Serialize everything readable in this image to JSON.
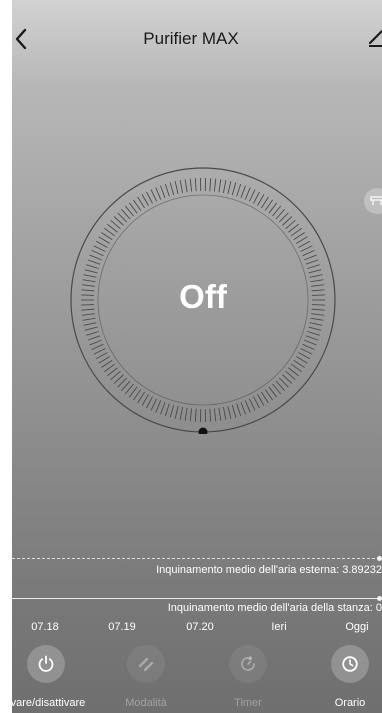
{
  "header": {
    "title": "Purifier MAX",
    "back_icon": "chevron-left-icon",
    "edit_icon": "pencil-icon"
  },
  "side_button": {
    "icon": "filter-icon"
  },
  "dial": {
    "status": "Off",
    "level_fraction": 0
  },
  "metrics": {
    "outdoor": "Inquinamento medio dell'aria esterna: 3.89232",
    "indoor": "Inquinamento medio dell'aria della stanza: 0"
  },
  "dates": [
    "07.18",
    "07.19",
    "07.20",
    "Ieri",
    "Oggi"
  ],
  "actions": [
    {
      "label": "Attivare/disattivare",
      "icon": "power-icon",
      "enabled": true
    },
    {
      "label": "Modalità",
      "icon": "mode-icon",
      "enabled": false
    },
    {
      "label": "Timer",
      "icon": "timer-icon",
      "enabled": false
    },
    {
      "label": "Orario",
      "icon": "clock-icon",
      "enabled": true
    }
  ],
  "colors": {
    "title": "#1a1a1a",
    "dial_ring": "#4a4a4a",
    "text": "#ffffff"
  }
}
